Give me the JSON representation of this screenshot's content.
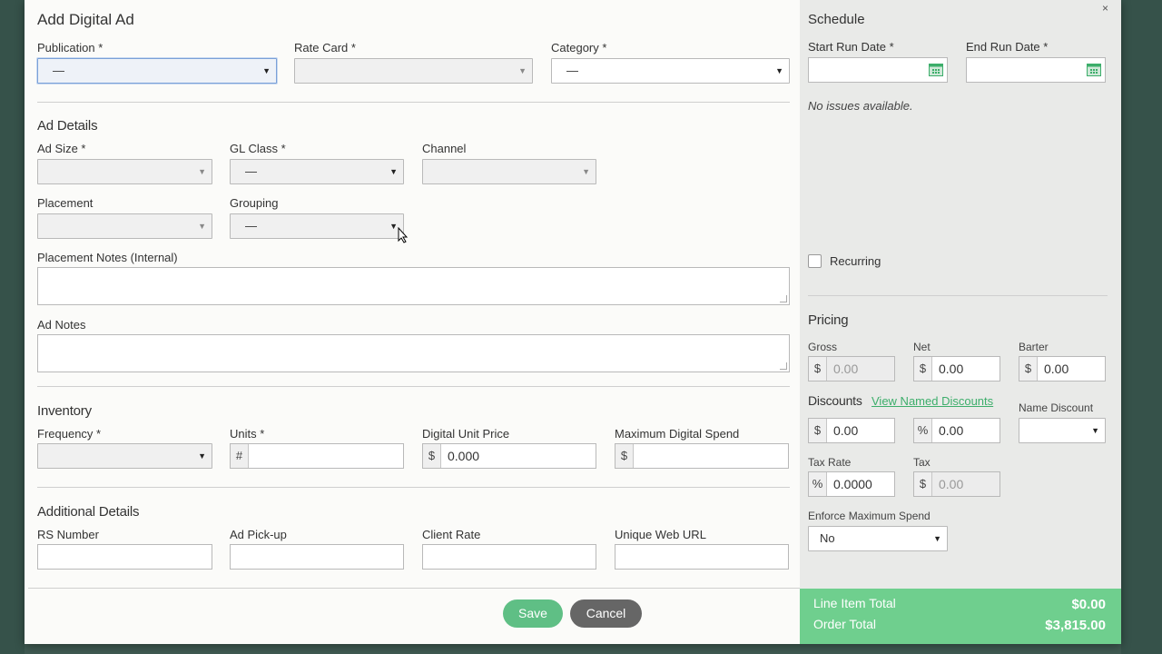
{
  "modal": {
    "title": "Add Digital Ad",
    "close_glyph": "×"
  },
  "top": {
    "publication": {
      "label": "Publication *",
      "value": "—"
    },
    "rate_card": {
      "label": "Rate Card *",
      "value": ""
    },
    "category": {
      "label": "Category *",
      "value": "—"
    }
  },
  "ad_details": {
    "heading": "Ad Details",
    "ad_size": {
      "label": "Ad Size *",
      "value": ""
    },
    "gl_class": {
      "label": "GL Class *",
      "value": "—"
    },
    "channel": {
      "label": "Channel",
      "value": ""
    },
    "placement": {
      "label": "Placement",
      "value": ""
    },
    "grouping": {
      "label": "Grouping",
      "value": "—"
    },
    "placement_notes": {
      "label": "Placement Notes (Internal)"
    },
    "ad_notes": {
      "label": "Ad Notes"
    }
  },
  "inventory": {
    "heading": "Inventory",
    "frequency": {
      "label": "Frequency *",
      "value": ""
    },
    "units": {
      "label": "Units *",
      "prefix": "#",
      "value": ""
    },
    "digital_unit_price": {
      "label": "Digital Unit Price",
      "prefix": "$",
      "value": "0.000"
    },
    "max_digital_spend": {
      "label": "Maximum Digital Spend",
      "prefix": "$",
      "value": ""
    }
  },
  "additional": {
    "heading": "Additional Details",
    "rs_number": {
      "label": "RS Number"
    },
    "ad_pickup": {
      "label": "Ad Pick-up"
    },
    "client_rate": {
      "label": "Client Rate"
    },
    "unique_web_url": {
      "label": "Unique Web URL"
    }
  },
  "actions": {
    "save": "Save",
    "cancel": "Cancel"
  },
  "schedule": {
    "heading": "Schedule",
    "start_label": "Start Run Date *",
    "end_label": "End Run Date *",
    "no_issues": "No issues available.",
    "recurring": "Recurring"
  },
  "pricing": {
    "heading": "Pricing",
    "gross": {
      "label": "Gross",
      "prefix": "$",
      "value": "0.00"
    },
    "net": {
      "label": "Net",
      "prefix": "$",
      "value": "0.00"
    },
    "barter": {
      "label": "Barter",
      "prefix": "$",
      "value": "0.00"
    },
    "discounts_heading": "Discounts",
    "view_named_discounts": "View Named Discounts",
    "name_discount_label": "Name Discount",
    "discount_amount": {
      "prefix": "$",
      "value": "0.00"
    },
    "discount_percent": {
      "prefix": "%",
      "value": "0.00"
    },
    "tax_rate": {
      "label": "Tax Rate",
      "prefix": "%",
      "value": "0.0000"
    },
    "tax": {
      "label": "Tax",
      "prefix": "$",
      "value": "0.00"
    },
    "enforce_max_spend": {
      "label": "Enforce Maximum Spend",
      "value": "No"
    }
  },
  "totals": {
    "line_item_label": "Line Item Total",
    "line_item_value": "$0.00",
    "order_label": "Order Total",
    "order_value": "$3,815.00"
  },
  "colors": {
    "accent_green": "#6fcf8e",
    "link_green": "#3dae6b",
    "cancel_gray": "#666666"
  },
  "icons": {
    "select_arrow": "▼",
    "calendar": "calendar-icon"
  }
}
